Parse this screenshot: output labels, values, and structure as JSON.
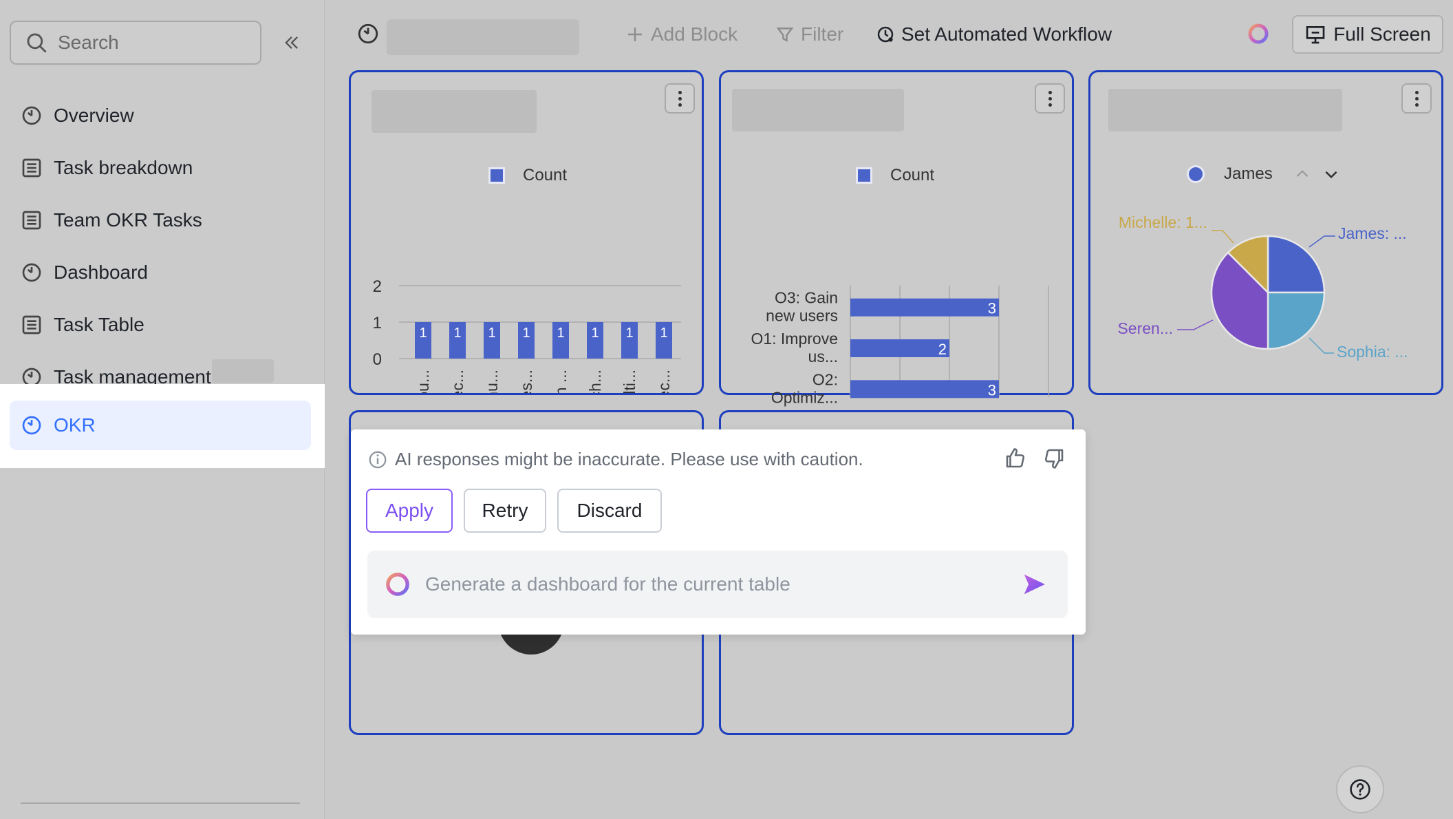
{
  "sidebar": {
    "search_placeholder": "Search",
    "items": [
      {
        "label": "Overview",
        "icon": "dashboard-icon"
      },
      {
        "label": "Task breakdown",
        "icon": "table-icon"
      },
      {
        "label": "Team OKR Tasks",
        "icon": "table-icon"
      },
      {
        "label": "Dashboard",
        "icon": "dashboard-icon"
      },
      {
        "label": "Task Table",
        "icon": "table-icon"
      },
      {
        "label": "Task management",
        "icon": "dashboard-icon"
      }
    ],
    "active_item": {
      "label": "OKR",
      "icon": "dashboard-icon"
    }
  },
  "toolbar": {
    "add_block": "Add Block",
    "filter": "Filter",
    "workflow": "Set Automated Workflow",
    "full_screen": "Full Screen"
  },
  "ai_popup": {
    "notice": "AI responses might be inaccurate. Please use with caution.",
    "apply": "Apply",
    "retry": "Retry",
    "discard": "Discard",
    "prompt_text": "Generate a dashboard for the current table"
  },
  "colors": {
    "accent": "#3370ff",
    "card_border": "#1d3fbf",
    "bar": "#4a63c9",
    "ai_purple": "#8a5cf6"
  },
  "chart_data": [
    {
      "type": "bar",
      "legend": [
        "Count"
      ],
      "categories": [
        "Encou...",
        "Collec...",
        "Formu...",
        "Asses...",
        "Push ...",
        "Patch...",
        "Multi...",
        "Collec..."
      ],
      "values": [
        1,
        1,
        1,
        1,
        1,
        1,
        1,
        1
      ],
      "data_labels": [
        "1",
        "1",
        "1",
        "1",
        "1",
        "1",
        "1",
        "1"
      ],
      "y_ticks": [
        "0",
        "1",
        "2"
      ],
      "ylim": [
        0,
        2
      ],
      "grid": true
    },
    {
      "type": "bar",
      "orientation": "horizontal",
      "legend": [
        "Count"
      ],
      "categories": [
        [
          "O3: Gain",
          "new users"
        ],
        [
          "O1: Improve",
          "us..."
        ],
        [
          "O2:",
          "Optimiz..."
        ]
      ],
      "values": [
        3,
        2,
        3
      ],
      "data_labels": [
        "3",
        "2",
        "3"
      ],
      "x_ticks": [
        "0",
        "1",
        "2",
        "3",
        "4"
      ],
      "xlim": [
        0,
        4
      ],
      "grid": true
    },
    {
      "type": "pie",
      "legend": [
        "James"
      ],
      "slices": [
        {
          "label": "James: ...",
          "value": 25,
          "color": "#4a63c9"
        },
        {
          "label": "Sophia: ...",
          "value": 25,
          "color": "#5aa3c9"
        },
        {
          "label": "Seren...",
          "value": 37.5,
          "color": "#7a4fc4"
        },
        {
          "label": "Michelle: 1...",
          "value": 12.5,
          "color": "#c9a84a"
        }
      ]
    }
  ]
}
